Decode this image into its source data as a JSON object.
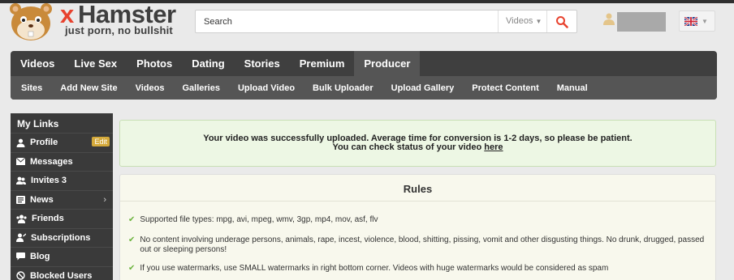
{
  "header": {
    "logo_x": "x",
    "logo_name": "Hamster",
    "logo_tagline": "just porn, no bullshit",
    "search": {
      "placeholder": "Search",
      "scope": "Videos"
    }
  },
  "nav": {
    "main": [
      "Videos",
      "Live Sex",
      "Photos",
      "Dating",
      "Stories",
      "Premium",
      "Producer"
    ],
    "active": "Producer",
    "sub": [
      "Sites",
      "Add New Site",
      "Videos",
      "Galleries",
      "Upload Video",
      "Bulk Uploader",
      "Upload Gallery",
      "Protect Content",
      "Manual"
    ]
  },
  "sidebar": {
    "title": "My Links",
    "items": [
      {
        "label": "Profile",
        "icon": "user-icon",
        "badge": "Edit"
      },
      {
        "label": "Messages",
        "icon": "envelope-icon"
      },
      {
        "label": "Invites 3",
        "icon": "users-icon"
      },
      {
        "label": "News",
        "icon": "news-icon",
        "arrow": "›"
      },
      {
        "label": "Friends",
        "icon": "friends-icon"
      },
      {
        "label": "Subscriptions",
        "icon": "subscriptions-icon"
      },
      {
        "label": "Blog",
        "icon": "comment-icon"
      },
      {
        "label": "Blocked Users",
        "icon": "blocked-icon"
      }
    ]
  },
  "notice": {
    "line1": "Your video was successfully uploaded. Average time for conversion is 1-2 days, so please be patient.",
    "line2_prefix": "You can check status of your video ",
    "link": "here"
  },
  "rules": {
    "title": "Rules",
    "items": [
      "Supported file types: mpg, avi, mpeg, wmv, 3gp, mp4, mov, asf, flv",
      "No content involving underage persons, animals, rape, incest, violence, blood, shitting, pissing, vomit and other disgusting things. No drunk, drugged, passed out or sleeping persons!",
      "If you use watermarks, use SMALL watermarks in right bottom corner. Videos with huge watermarks would be considered as spam"
    ]
  },
  "colors": {
    "accent": "#e8422e",
    "nav": "#3f3f3f",
    "success_bg": "#edf7e4",
    "check": "#6cb33e",
    "edit_badge": "#d4a93a"
  }
}
